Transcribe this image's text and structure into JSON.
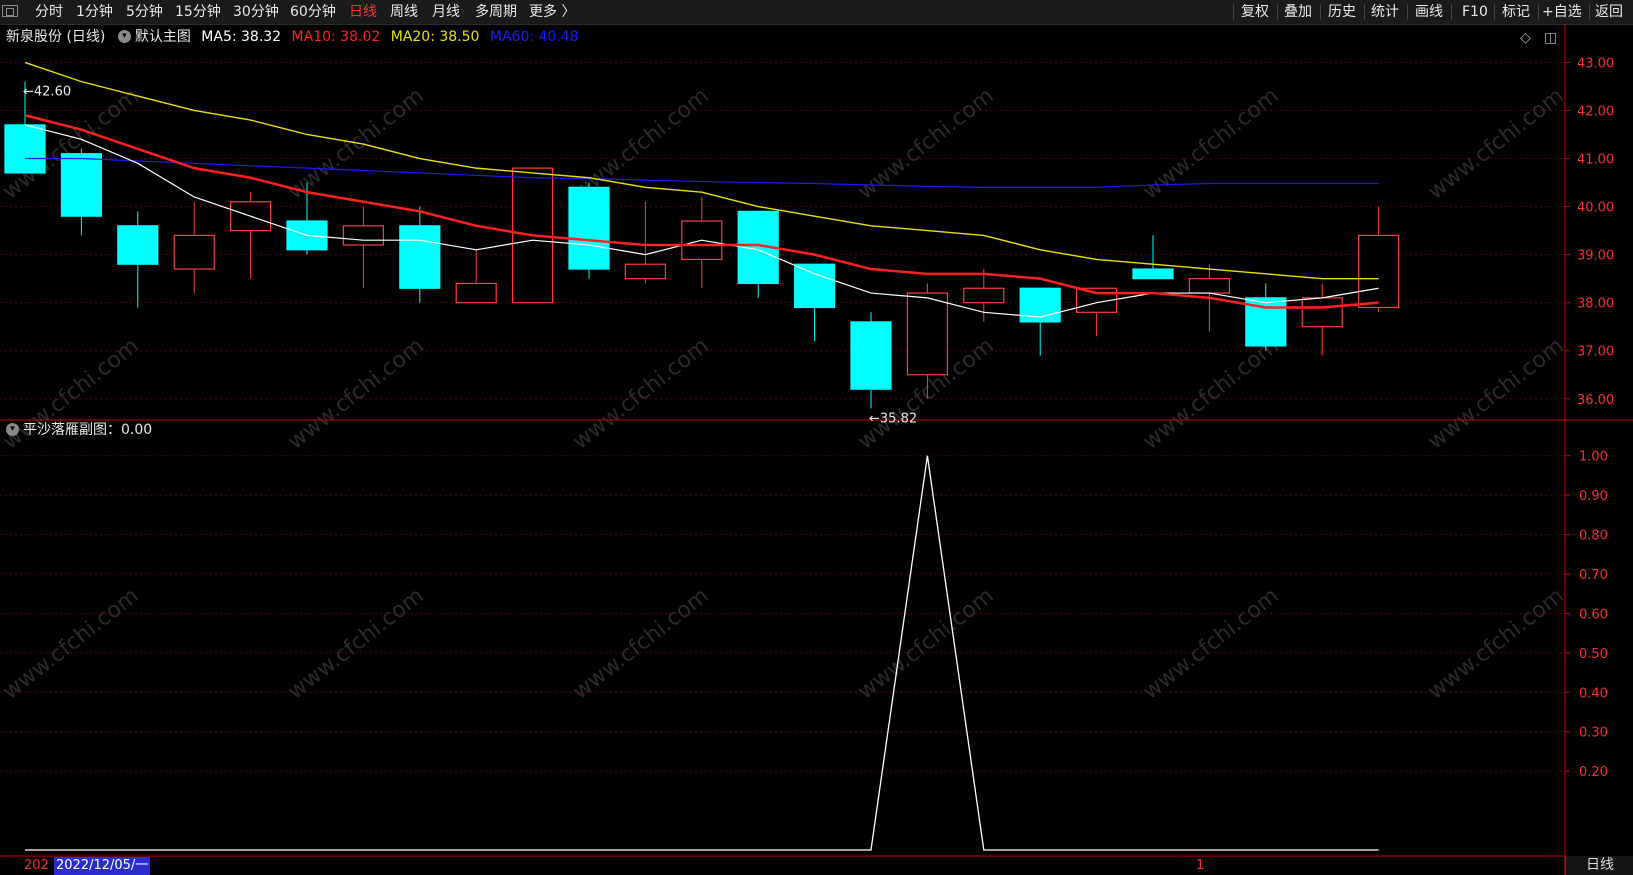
{
  "toolbar": {
    "periods": [
      {
        "label": "分时",
        "active": false
      },
      {
        "label": "1分钟",
        "active": false
      },
      {
        "label": "5分钟",
        "active": false
      },
      {
        "label": "15分钟",
        "active": false
      },
      {
        "label": "30分钟",
        "active": false
      },
      {
        "label": "60分钟",
        "active": false
      },
      {
        "label": "日线",
        "active": true
      },
      {
        "label": "周线",
        "active": false
      },
      {
        "label": "月线",
        "active": false
      },
      {
        "label": "多周期",
        "active": false
      },
      {
        "label": "更多 〉",
        "active": false
      }
    ],
    "right_buttons": [
      "复权",
      "叠加",
      "历史",
      "统计",
      "画线",
      "F10",
      "标记",
      "+自选",
      "返回"
    ]
  },
  "main_chart": {
    "stock_title": "新泉股份 (日线)",
    "template_label": "默认主图",
    "ma": [
      {
        "label": "MA5: 38.32",
        "color": "#ffffff"
      },
      {
        "label": "MA10: 38.02",
        "color": "#ff2020"
      },
      {
        "label": "MA20: 38.50",
        "color": "#e8e000"
      },
      {
        "label": "MA60: 40.48",
        "color": "#1a1aff"
      }
    ],
    "high_marker": "42.60",
    "low_marker": "35.82",
    "y_ticks": [
      "43.00",
      "42.00",
      "41.00",
      "40.00",
      "39.00",
      "38.00",
      "37.00",
      "36.00"
    ]
  },
  "sub_chart": {
    "title": "平沙落雁副图：0.00",
    "y_ticks": [
      "1.00",
      "0.90",
      "0.80",
      "0.70",
      "0.60",
      "0.50",
      "0.40",
      "0.30",
      "0.20"
    ]
  },
  "bottom": {
    "year_prefix": "202",
    "selected_date": "2022/12/05/一",
    "marker": "1",
    "period": "日线"
  },
  "watermark": "www.cfchi.com",
  "colors": {
    "up": "#ff3b3b",
    "down": "#00ffff",
    "ma5": "#ffffff",
    "ma10": "#ff2020",
    "ma20": "#e8e000",
    "ma60": "#1a1aff",
    "axis": "#cc0000"
  },
  "chart_data": {
    "type": "candlestick",
    "candles": [
      {
        "open": 41.7,
        "high": 42.6,
        "low": 40.7,
        "close": 40.7
      },
      {
        "open": 41.1,
        "high": 41.2,
        "low": 39.4,
        "close": 39.8
      },
      {
        "open": 39.6,
        "high": 39.9,
        "low": 37.9,
        "close": 38.8
      },
      {
        "open": 38.7,
        "high": 40.1,
        "low": 38.2,
        "close": 39.4
      },
      {
        "open": 39.5,
        "high": 40.3,
        "low": 38.5,
        "close": 40.1
      },
      {
        "open": 39.7,
        "high": 40.5,
        "low": 39.0,
        "close": 39.1
      },
      {
        "open": 39.2,
        "high": 40.0,
        "low": 38.3,
        "close": 39.6
      },
      {
        "open": 39.6,
        "high": 40.0,
        "low": 38.0,
        "close": 38.3
      },
      {
        "open": 38.0,
        "high": 39.1,
        "low": 38.0,
        "close": 38.4
      },
      {
        "open": 38.0,
        "high": 40.8,
        "low": 38.0,
        "close": 40.8
      },
      {
        "open": 40.4,
        "high": 40.5,
        "low": 38.5,
        "close": 38.7
      },
      {
        "open": 38.5,
        "high": 40.1,
        "low": 38.4,
        "close": 38.8
      },
      {
        "open": 38.9,
        "high": 40.2,
        "low": 38.3,
        "close": 39.7
      },
      {
        "open": 39.9,
        "high": 39.9,
        "low": 38.1,
        "close": 38.4
      },
      {
        "open": 38.8,
        "high": 38.8,
        "low": 37.2,
        "close": 37.9
      },
      {
        "open": 37.6,
        "high": 37.8,
        "low": 35.8,
        "close": 36.2
      },
      {
        "open": 36.5,
        "high": 38.4,
        "low": 36.0,
        "close": 38.2
      },
      {
        "open": 38.0,
        "high": 38.7,
        "low": 37.6,
        "close": 38.3
      },
      {
        "open": 38.3,
        "high": 38.3,
        "low": 36.9,
        "close": 37.6
      },
      {
        "open": 37.8,
        "high": 38.3,
        "low": 37.3,
        "close": 38.3
      },
      {
        "open": 38.7,
        "high": 39.4,
        "low": 38.5,
        "close": 38.5
      },
      {
        "open": 38.2,
        "high": 38.8,
        "low": 37.4,
        "close": 38.5
      },
      {
        "open": 38.1,
        "high": 38.4,
        "low": 37.0,
        "close": 37.1
      },
      {
        "open": 37.5,
        "high": 38.4,
        "low": 36.9,
        "close": 38.1
      },
      {
        "open": 37.9,
        "high": 40.0,
        "low": 37.8,
        "close": 39.4
      }
    ],
    "ma5": [
      41.7,
      41.4,
      40.9,
      40.2,
      39.8,
      39.4,
      39.3,
      39.3,
      39.1,
      39.3,
      39.2,
      39.0,
      39.3,
      39.1,
      38.6,
      38.2,
      38.1,
      37.8,
      37.7,
      38.0,
      38.2,
      38.2,
      38.0,
      38.1,
      38.3
    ],
    "ma10": [
      41.9,
      41.6,
      41.2,
      40.8,
      40.6,
      40.3,
      40.1,
      39.9,
      39.6,
      39.4,
      39.3,
      39.2,
      39.2,
      39.2,
      39.0,
      38.7,
      38.6,
      38.6,
      38.5,
      38.2,
      38.2,
      38.1,
      37.9,
      37.9,
      38.0
    ],
    "ma20": [
      43.0,
      42.6,
      42.3,
      42.0,
      41.8,
      41.5,
      41.3,
      41.0,
      40.8,
      40.7,
      40.6,
      40.4,
      40.3,
      40.0,
      39.8,
      39.6,
      39.5,
      39.4,
      39.1,
      38.9,
      38.8,
      38.7,
      38.6,
      38.5,
      38.5
    ],
    "ma60": [
      41.0,
      41.0,
      40.95,
      40.9,
      40.85,
      40.8,
      40.75,
      40.7,
      40.65,
      40.6,
      40.58,
      40.55,
      40.52,
      40.5,
      40.48,
      40.45,
      40.42,
      40.4,
      40.4,
      40.4,
      40.45,
      40.48,
      40.48,
      40.48,
      40.48
    ],
    "y_range": [
      35.6,
      43.3
    ],
    "sub_values": [
      0,
      0,
      0,
      0,
      0,
      0,
      0,
      0,
      0,
      0,
      0,
      0,
      0,
      0,
      0,
      0,
      1,
      0,
      0,
      0,
      0,
      0,
      0,
      0,
      0
    ],
    "sub_y_range": [
      0,
      1.05
    ]
  }
}
